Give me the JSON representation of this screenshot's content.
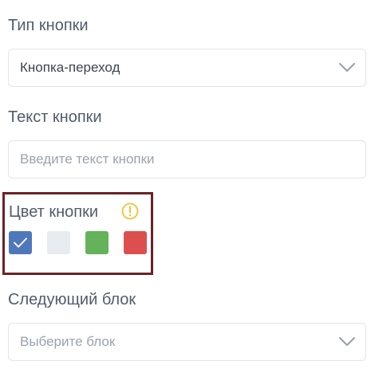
{
  "button_type": {
    "label": "Тип кнопки",
    "selected": "Кнопка-переход",
    "icon": "chevron-down-icon"
  },
  "button_text": {
    "label": "Текст кнопки",
    "value": "",
    "placeholder": "Введите текст кнопки"
  },
  "button_color": {
    "label": "Цвет кнопки",
    "info_icon": "warning-circle-icon",
    "info_icon_color": "#f2c230",
    "highlight_border_color": "#6b2226",
    "swatches": [
      {
        "name": "blue",
        "color": "#4f78bb",
        "selected": true
      },
      {
        "name": "light-gray",
        "color": "#e8ebef",
        "selected": false
      },
      {
        "name": "green",
        "color": "#64b35a",
        "selected": false
      },
      {
        "name": "red",
        "color": "#dd4f4f",
        "selected": false
      }
    ]
  },
  "next_block": {
    "label": "Следующий блок",
    "placeholder": "Выберите блок",
    "icon": "chevron-down-icon"
  }
}
